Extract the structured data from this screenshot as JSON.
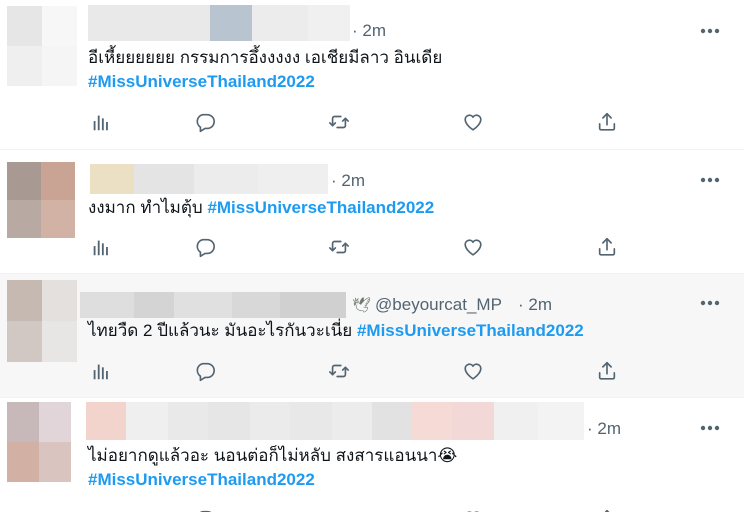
{
  "tweets": [
    {
      "time": "· 2m",
      "line1": "อีเหี้ยยยยยย กรรมการอึ้งงงงง  เอเชียมีลาว อินเดีย",
      "hashtag": "#MissUniverseThailand2022"
    },
    {
      "time": "· 2m",
      "line1": "งงมาก ทำไมตุ้บ ",
      "hashtag": "#MissUniverseThailand2022"
    },
    {
      "handle": "@beyourcat_MP",
      "time": "· 2m",
      "line1": "ไทยวืด 2 ปีแล้วนะ มันอะไรกันวะเนี่ย  ",
      "hashtag": "#MissUniverseThailand2022"
    },
    {
      "time": "· 2m",
      "line1": "ไม่อยากดูแล้วอะ นอนต่อก็ไม่หลับ สงสารแอนนา😭",
      "hashtag": "#MissUniverseThailand2022"
    }
  ],
  "icons": {
    "reply": "reply-icon",
    "retweet": "retweet-icon",
    "like": "heart-icon",
    "share": "share-icon",
    "analytics": "analytics-icon",
    "more": "more-options-icon",
    "handle_emoji": "dove-icon"
  },
  "colors": {
    "hashtag": "#1d9bf0",
    "muted": "#536471",
    "highlight_bg": "#f7f7f7"
  }
}
